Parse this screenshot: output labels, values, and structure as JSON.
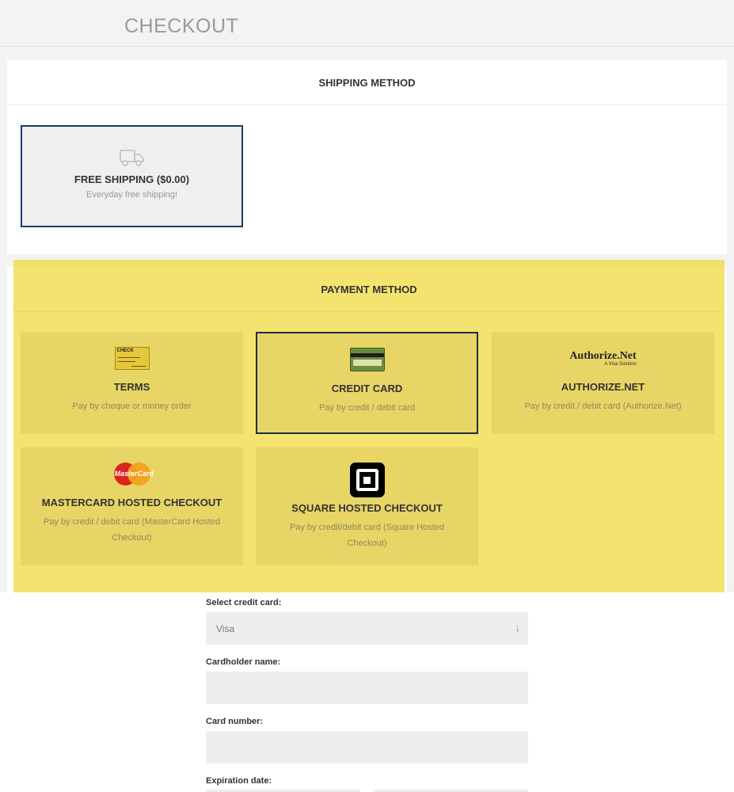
{
  "header": {
    "title": "CHECKOUT"
  },
  "shipping": {
    "heading": "SHIPPING METHOD",
    "option": {
      "title": "FREE SHIPPING ($0.00)",
      "desc": "Everyday free shipping!",
      "icon": "truck-icon"
    }
  },
  "payment": {
    "heading": "PAYMENT METHOD",
    "highlight_color": "#eed425",
    "selected": "CREDIT CARD",
    "methods": [
      {
        "title": "TERMS",
        "desc": "Pay by cheque or money order",
        "logo": "check-logo",
        "logo_text": "CHECK"
      },
      {
        "title": "CREDIT CARD",
        "desc": "Pay by credit / debit card",
        "logo": "credit-card-logo"
      },
      {
        "title": "AUTHORIZE.NET",
        "desc": "Pay by credit / debit card (Authorize.Net)",
        "logo": "authorize-net-logo",
        "logo_text": "Authorize.Net",
        "logo_subtext": "A Visa Solution"
      },
      {
        "title": "MASTERCARD HOSTED CHECKOUT",
        "desc": "Pay by credit / debit card (MasterCard Hosted Checkout)",
        "logo": "mastercard-logo",
        "logo_text": "MasterCard"
      },
      {
        "title": "SQUARE HOSTED CHECKOUT",
        "desc": "Pay by credit/debit card (Square Hosted Checkout)",
        "logo": "square-logo"
      }
    ]
  },
  "form": {
    "select_label": "Select credit card:",
    "select_value": "Visa",
    "cardholder_label": "Cardholder name:",
    "cardholder_value": "",
    "number_label": "Card number:",
    "number_value": "",
    "expiration_label": "Expiration date:"
  }
}
